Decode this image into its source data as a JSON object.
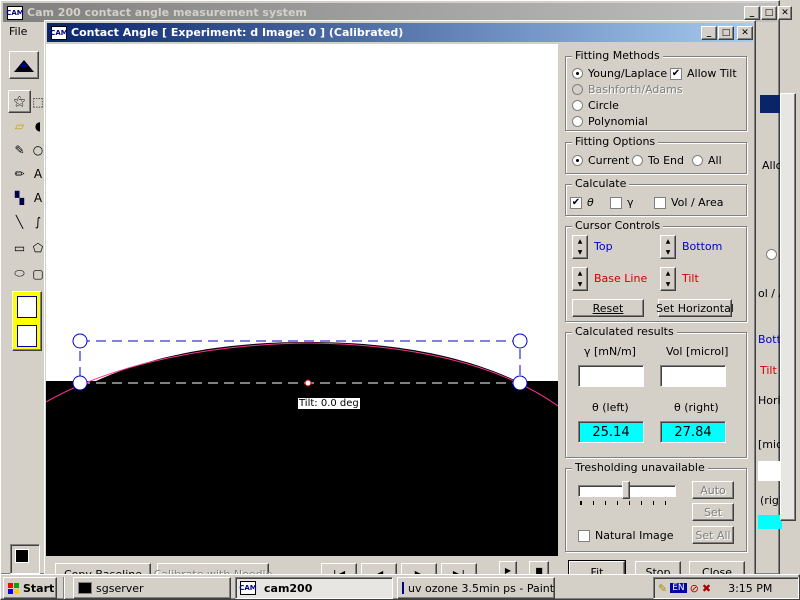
{
  "main_window": {
    "title": "Cam 200 contact angle measurement system",
    "menu": [
      "File",
      "E"
    ]
  },
  "child_window": {
    "title": "Contact Angle [ Experiment: d  Image: 0 ]  (Calibrated)",
    "tilt_label": "Tilt: 0.0 deg"
  },
  "fitting_methods": {
    "label": "Fitting Methods",
    "options": [
      "Young/Laplace",
      "Bashforth/Adams",
      "Circle",
      "Polynomial"
    ],
    "selected": "Young/Laplace",
    "allow_tilt_label": "Allow Tilt",
    "allow_tilt_checked": true
  },
  "fitting_options": {
    "label": "Fitting Options",
    "options": [
      "Current",
      "To End",
      "All"
    ],
    "selected": "Current"
  },
  "calculate": {
    "label": "Calculate",
    "theta": "θ",
    "gamma": "γ",
    "vol_area": "Vol / Area",
    "theta_checked": true
  },
  "cursor_controls": {
    "label": "Cursor Controls",
    "top": "Top",
    "bottom": "Bottom",
    "base_line": "Base Line",
    "tilt": "Tilt",
    "reset": "Reset",
    "set_horizontal": "Set Horizontal"
  },
  "results": {
    "label": "Calculated results",
    "gamma_label": "γ  [mN/m]",
    "vol_label": "Vol [microl]",
    "theta_left_label": "θ  (left)",
    "theta_right_label": "θ  (right)",
    "theta_left_value": "25.14",
    "theta_right_value": "27.84"
  },
  "threshold": {
    "label": "Tresholding unavailable",
    "auto": "Auto",
    "set": "Set",
    "set_all": "Set All",
    "natural_image": "Natural Image"
  },
  "bottom_buttons": {
    "copy_baseline": "Copy Baseline",
    "calibrate_with_needle": "Calibrate with Needle",
    "fit": "Fit",
    "stop": "Stop",
    "close": "Close"
  },
  "right_fragments": {
    "allo": "Allo",
    "vol": "ol / A",
    "bottom": "Botto",
    "tilt": "Tilt",
    "horiz": "Horizo",
    "micro": "[micro",
    "righ": "(righ"
  },
  "taskbar": {
    "start": "Start",
    "tasks": [
      "sgserver",
      "cam200",
      "uv ozone 3.5min ps - Paint"
    ],
    "lang": "EN",
    "time": "3:15 PM"
  },
  "colors": {
    "titlebar": "#0a246a",
    "face": "#d4d0c8",
    "result_highlight": "#00ffff",
    "cursor_blue": "#0000cc",
    "cursor_red": "#cc0000",
    "fit_line": "#ff3399"
  }
}
